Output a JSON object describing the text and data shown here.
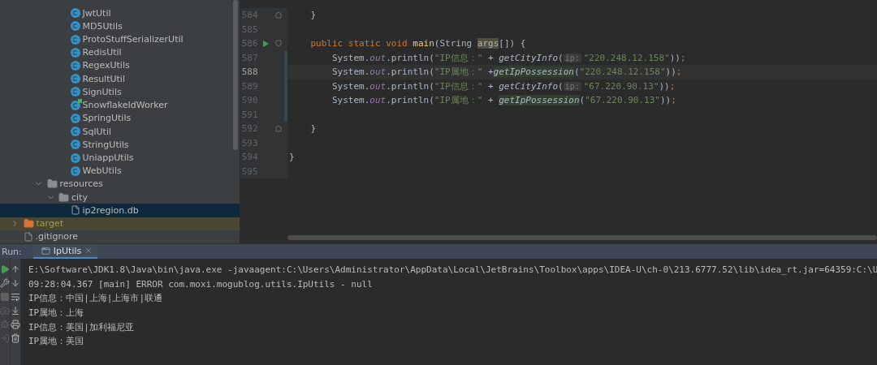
{
  "project_tree": [
    {
      "kind": "group",
      "children": [
        {
          "kind": "group",
          "children": [
            {
              "kind": "group",
              "children": [
                {
                  "kind": "group",
                  "children": [
                    {
                      "label": "JwtUtil",
                      "kind": "class",
                      "selected": false
                    },
                    {
                      "label": "MD5Utils",
                      "kind": "class",
                      "selected": false
                    },
                    {
                      "label": "ProtoStuffSerializerUtil",
                      "kind": "class",
                      "selected": false
                    },
                    {
                      "label": "RedisUtil",
                      "kind": "class",
                      "selected": false
                    },
                    {
                      "label": "RegexUtils",
                      "kind": "class",
                      "selected": false
                    },
                    {
                      "label": "ResultUtil",
                      "kind": "class",
                      "selected": false
                    },
                    {
                      "label": "SignUtils",
                      "kind": "class",
                      "selected": false
                    },
                    {
                      "label": "SnowflakeIdWorker",
                      "kind": "class_runnable",
                      "selected": false
                    },
                    {
                      "label": "SpringUtils",
                      "kind": "class",
                      "selected": false
                    },
                    {
                      "label": "SqlUtil",
                      "kind": "class",
                      "selected": false
                    },
                    {
                      "label": "StringUtils",
                      "kind": "class",
                      "selected": false
                    },
                    {
                      "label": "UniappUtils",
                      "kind": "class",
                      "selected": false
                    },
                    {
                      "label": "WebUtils",
                      "kind": "class",
                      "selected": false
                    }
                  ]
                }
              ]
            },
            {
              "label": "resources",
              "kind": "resources_folder",
              "expanded": true,
              "selected": false,
              "children": [
                {
                  "label": "city",
                  "kind": "folder",
                  "expanded": true,
                  "selected": false,
                  "children": [
                    {
                      "label": "ip2region.db",
                      "kind": "file",
                      "selected": true
                    }
                  ]
                }
              ]
            }
          ]
        }
      ]
    },
    {
      "label": "target",
      "kind": "excluded_folder",
      "expanded": false,
      "selected": false
    },
    {
      "label": ".gitignore",
      "kind": "ignore_file",
      "selected": false
    }
  ],
  "editor": {
    "lines": [
      {
        "number": "584",
        "current": false,
        "changed": false,
        "foldable": true,
        "runnable": false,
        "tokens": [
          {
            "text": "    }",
            "kind": "plain"
          }
        ]
      },
      {
        "number": "585",
        "current": false,
        "changed": false,
        "foldable": false,
        "runnable": false
      },
      {
        "number": "586",
        "current": false,
        "changed": false,
        "foldable": true,
        "runnable": true,
        "tokens": [
          {
            "text": "    public static void ",
            "kind": "keyword"
          },
          {
            "text": "main",
            "kind": "declaration"
          },
          {
            "text": "(String ",
            "kind": "plain"
          },
          {
            "text": "args",
            "kind": "param_marked"
          },
          {
            "text": "[]) {",
            "kind": "plain"
          }
        ]
      },
      {
        "number": "587",
        "current": false,
        "changed": true,
        "foldable": false,
        "runnable": false,
        "tokens": [
          {
            "text": "        System.",
            "kind": "plain"
          },
          {
            "text": "out",
            "kind": "field"
          },
          {
            "text": ".println(",
            "kind": "plain"
          },
          {
            "text": "\"IP信息：\"",
            "kind": "string"
          },
          {
            "text": " + ",
            "kind": "plain"
          },
          {
            "text": "getCityInfo",
            "kind": "method"
          },
          {
            "text": "(",
            "kind": "plain"
          },
          {
            "text": "ip:",
            "kind": "hint"
          },
          {
            "text": "\"220.248.12.158\"",
            "kind": "string"
          },
          {
            "text": "))",
            "kind": "plain"
          },
          {
            "text": ";",
            "kind": "keyword"
          }
        ]
      },
      {
        "number": "588",
        "current": true,
        "changed": true,
        "foldable": false,
        "runnable": false,
        "tokens": [
          {
            "text": "        System.",
            "kind": "plain"
          },
          {
            "text": "out",
            "kind": "field"
          },
          {
            "text": ".println(",
            "kind": "plain"
          },
          {
            "text": "\"IP属地：\"",
            "kind": "string"
          },
          {
            "text": " +",
            "kind": "plain"
          },
          {
            "text": "getIpPossession",
            "kind": "method_marked"
          },
          {
            "text": "(",
            "kind": "plain"
          },
          {
            "text": "\"220.248.12.158\"",
            "kind": "string"
          },
          {
            "text": "))",
            "kind": "plain"
          },
          {
            "text": ";",
            "kind": "keyword"
          }
        ]
      },
      {
        "number": "589",
        "current": false,
        "changed": true,
        "foldable": false,
        "runnable": false,
        "tokens": [
          {
            "text": "        System.",
            "kind": "plain"
          },
          {
            "text": "out",
            "kind": "field"
          },
          {
            "text": ".println(",
            "kind": "plain"
          },
          {
            "text": "\"IP信息：\"",
            "kind": "string"
          },
          {
            "text": " + ",
            "kind": "plain"
          },
          {
            "text": "getCityInfo",
            "kind": "method"
          },
          {
            "text": "(",
            "kind": "plain"
          },
          {
            "text": "ip:",
            "kind": "hint"
          },
          {
            "text": "\"67.220.90.13\"",
            "kind": "string"
          },
          {
            "text": "))",
            "kind": "plain"
          },
          {
            "text": ";",
            "kind": "keyword"
          }
        ]
      },
      {
        "number": "590",
        "current": false,
        "changed": true,
        "foldable": false,
        "runnable": false,
        "tokens": [
          {
            "text": "        System.",
            "kind": "plain"
          },
          {
            "text": "out",
            "kind": "field"
          },
          {
            "text": ".println(",
            "kind": "plain"
          },
          {
            "text": "\"IP属地：\"",
            "kind": "string"
          },
          {
            "text": " + ",
            "kind": "plain"
          },
          {
            "text": "getIpPossession",
            "kind": "method_marked"
          },
          {
            "text": "(",
            "kind": "plain"
          },
          {
            "text": "\"67.220.90.13\"",
            "kind": "string"
          },
          {
            "text": "))",
            "kind": "plain"
          },
          {
            "text": ";",
            "kind": "keyword"
          }
        ]
      },
      {
        "number": "591",
        "current": false,
        "changed": true,
        "foldable": false,
        "runnable": false
      },
      {
        "number": "592",
        "current": false,
        "changed": false,
        "foldable": true,
        "runnable": false,
        "tokens": [
          {
            "text": "    }",
            "kind": "plain"
          }
        ]
      },
      {
        "number": "593",
        "current": false,
        "changed": false,
        "foldable": false,
        "runnable": false
      },
      {
        "number": "594",
        "current": false,
        "changed": false,
        "foldable": false,
        "runnable": false,
        "tokens": [
          {
            "text": "}",
            "kind": "plain"
          }
        ]
      },
      {
        "number": "595",
        "current": false,
        "changed": false,
        "foldable": false,
        "runnable": false
      }
    ]
  },
  "run_panel": {
    "label": "Run:",
    "tabs": [
      {
        "label": "IpUtils",
        "selected": true
      }
    ],
    "console": [
      "E:\\Software\\JDK1.8\\Java\\bin\\java.exe -javaagent:C:\\Users\\Administrator\\AppData\\Local\\JetBrains\\Toolbox\\apps\\IDEA-U\\ch-0\\213.6777.52\\lib\\idea_rt.jar=64359:C:\\U",
      "09:28:04.367 [main] ERROR com.moxi.mogublog.utils.IpUtils - null",
      "IP信息：中国|上海|上海市|联通",
      "IP属地：上海",
      "IP信息：美国|加利福尼亚",
      "IP属地：美国"
    ]
  }
}
